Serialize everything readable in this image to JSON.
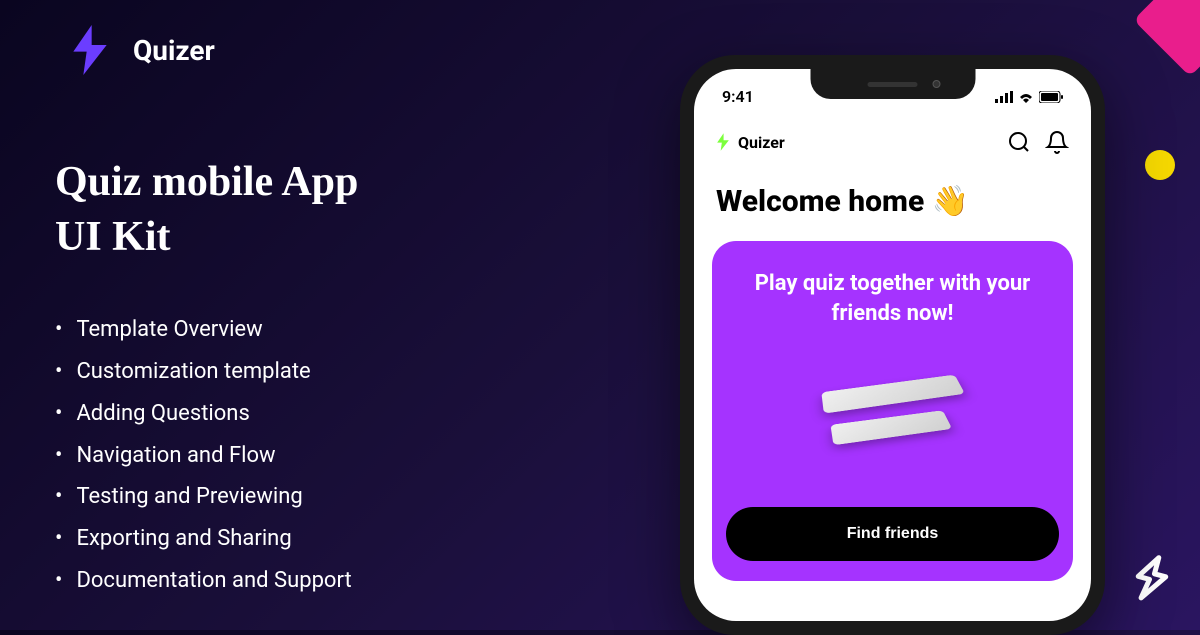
{
  "brand": {
    "name": "Quizer"
  },
  "hero": {
    "title_line1": "Quiz mobile App",
    "title_line2": "UI Kit"
  },
  "features": [
    "Template Overview",
    "Customization template",
    "Adding Questions",
    "Navigation and Flow",
    "Testing and Previewing",
    "Exporting and Sharing",
    "Documentation and Support"
  ],
  "phone": {
    "status": {
      "time": "9:41"
    },
    "app": {
      "name": "Quizer",
      "welcome": "Welcome home 👋",
      "card": {
        "title": "Play quiz together with your friends now!",
        "button": "Find friends"
      }
    }
  },
  "colors": {
    "accent_purple": "#6b3dff",
    "card_purple": "#a533ff",
    "pink": "#e91e8c",
    "yellow": "#f5d800",
    "green": "#7cff3d"
  }
}
